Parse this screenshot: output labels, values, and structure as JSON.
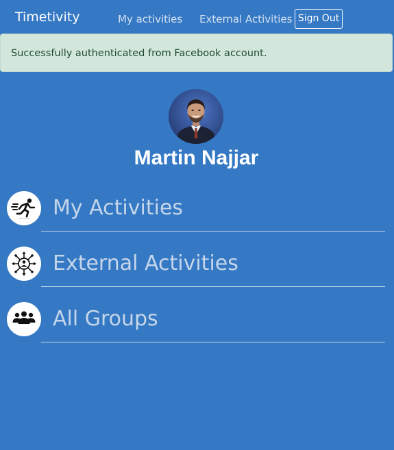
{
  "navbar": {
    "brand": "Timetivity",
    "links": [
      "My activities",
      "External Activities"
    ],
    "sign_out": "Sign Out"
  },
  "alert": {
    "message": "Successfully authenticated from Facebook account.",
    "type": "success"
  },
  "profile": {
    "name": "Martin Najjar",
    "avatar": "user-photo"
  },
  "menu": [
    {
      "label": "My Activities",
      "icon": "running-person-icon"
    },
    {
      "label": "External Activities",
      "icon": "network-person-icon"
    },
    {
      "label": "All Groups",
      "icon": "group-icon"
    }
  ],
  "colors": {
    "background": "#3578c4",
    "alert_background": "#d2e6dc",
    "alert_text": "#1f4a2f",
    "menu_text": "#c5d6ea",
    "white": "#ffffff"
  }
}
